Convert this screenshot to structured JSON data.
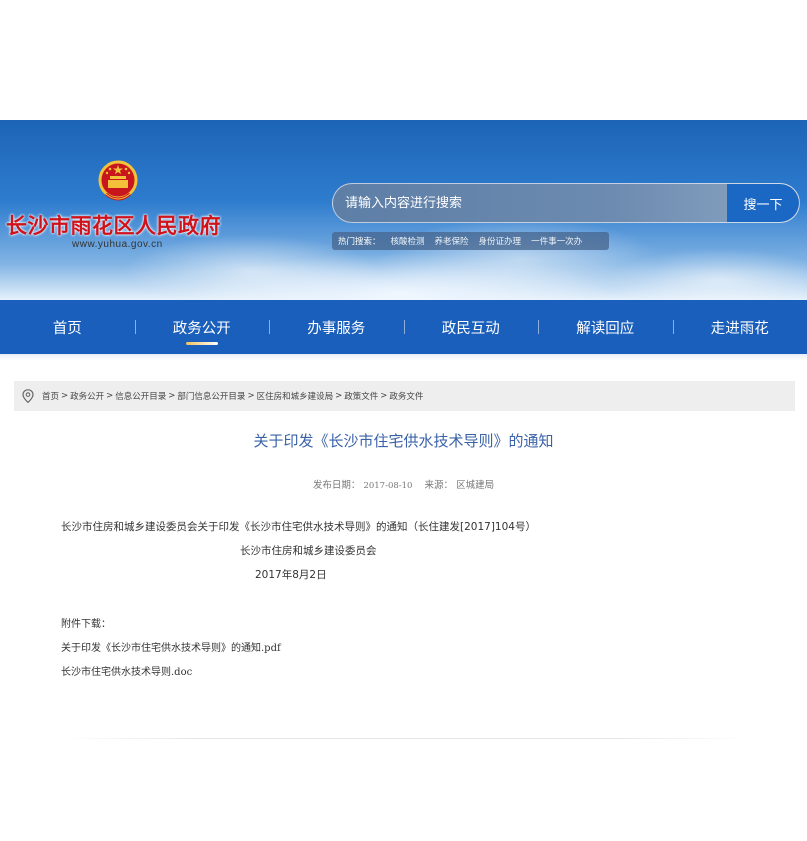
{
  "header": {
    "site_title": "长沙市雨花区人民政府",
    "site_url": "www.yuhua.gov.cn",
    "search": {
      "placeholder": "请输入内容进行搜索",
      "button_label": "搜一下"
    },
    "hot": {
      "label": "热门搜索：",
      "items": [
        "核酸检测",
        "养老保险",
        "身份证办理",
        "一件事一次办"
      ]
    }
  },
  "nav": {
    "items": [
      "首页",
      "政务公开",
      "办事服务",
      "政民互动",
      "解读回应",
      "走进雨花"
    ],
    "active_index": 1
  },
  "breadcrumb": {
    "items": [
      "首页",
      "政务公开",
      "信息公开目录",
      "部门信息公开目录",
      "区住房和城乡建设局",
      "政策文件",
      "政务文件"
    ],
    "separator": ">"
  },
  "article": {
    "title": "关于印发《长沙市住宅供水技术导则》的通知",
    "date_label": "发布日期：",
    "date": "2017-08-10",
    "source_label": "来源：",
    "source": "区城建局",
    "body": {
      "line1": "长沙市住房和城乡建设委员会关于印发《长沙市住宅供水技术导则》的通知（长住建发[2017]104号）",
      "issuer": "长沙市住房和城乡建设委员会",
      "date": "2017年8月2日"
    },
    "attachments": {
      "label": "附件下载：",
      "files": [
        "关于印发《长沙市住宅供水技术导则》的通知.pdf",
        "长沙市住宅供水技术导则.doc"
      ]
    }
  },
  "colors": {
    "nav_bg": "#1a5fbc",
    "title_red": "#d0121b",
    "article_title": "#3a62a8",
    "search_button": "#1a67c4"
  },
  "icons": [
    "national-emblem-icon",
    "location-pin-icon"
  ]
}
